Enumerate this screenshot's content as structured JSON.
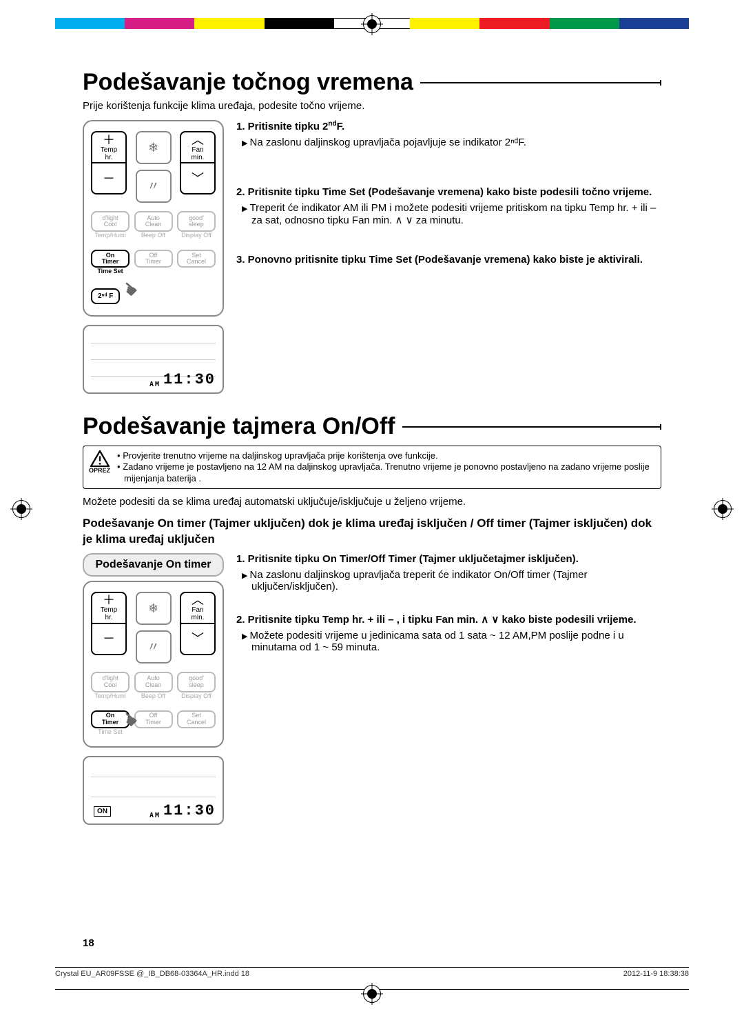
{
  "section1": {
    "title": "Podešavanje točnog vremena",
    "intro": "Prije korištenja funkcije klima uređaja, podesite točno vrijeme.",
    "steps": [
      {
        "lead": "1.   Pritisnite tipku 2",
        "lead_sup": "nd",
        "lead_tail": "F.",
        "body": "Na zaslonu daljinskog upravljača pojavljuje se indikator 2ⁿᵈF."
      },
      {
        "lead": "2.   Pritisnite tipku Time Set (Podešavanje vremena) kako biste podesili točno vrijeme.",
        "body": "Treperit će indikator AM ili PM i možete podesiti vrijeme pritiskom na tipku Temp hr. + ili – za sat, odnosno tipku Fan min. ∧ ∨  za minutu."
      },
      {
        "lead": "3.   Ponovno pritisnite tipku Time Set (Podešavanje vremena) kako biste je aktivirali.",
        "body": ""
      }
    ],
    "lcd": {
      "am": "AM",
      "time": "11:30"
    }
  },
  "section2": {
    "title": "Podešavanje tajmera On/Off",
    "caution_label": "OPREZ",
    "caution": [
      "Provjerite trenutno vrijeme na daljinskog upravljača prije korištenja ove funkcije.",
      "Zadano vrijeme je postavljeno na 12 AM na daljinskog upravljača. Trenutno vrijeme je ponovno postavljeno na zadano vrijeme poslije mijenjanja baterija ."
    ],
    "intro": "Možete podesiti da se klima uređaj automatski uključuje/isključuje u željeno vrijeme.",
    "subhead": "Podešavanje On timer (Tajmer uključen) dok je klima uređaj isključen / Off timer (Tajmer isključen) dok je klima uređaj uključen",
    "panel_label": "Podešavanje On timer",
    "steps": [
      {
        "lead": "1.   Pritisnite tipku On Timer/Off Timer (Tajmer uključetajmer isključen).",
        "body": "Na zaslonu daljinskog upravljača treperit će indikator On/Off timer (Tajmer uključen/isključen)."
      },
      {
        "lead": "2.   Pritisnite tipku Temp hr. + ili – , i tipku Fan min. ∧ ∨  kako biste podesili vrijeme.",
        "body": "Možete podesiti vrijeme u jedinicama sata od 1 sata ~ 12 AM,PM poslije podne i u minutama od 1 ~ 59 minuta."
      }
    ],
    "lcd": {
      "on": "ON",
      "am": "AM",
      "time": "11:30"
    }
  },
  "remote": {
    "temp": "Temp",
    "hr": "hr.",
    "fan": "Fan",
    "min": "min.",
    "dlight": "d'light",
    "cool": "Cool",
    "auto": "Auto",
    "clean": "Clean",
    "good": "good'",
    "sleep": "sleep",
    "sub1": "Temp/Humi",
    "sub2": "Beep Off",
    "sub3": "Display Off",
    "on": "On",
    "timer": "Timer",
    "off": "Off",
    "set": "Set",
    "cancel": "Cancel",
    "timeset": "Time Set",
    "secf": "2ⁿᵈ F"
  },
  "page_number": "18",
  "footer": {
    "file": "Crystal  EU_AR09FSSE @_IB_DB68-03364A_HR.indd   18",
    "date": "2012-11-9   18:38:38"
  },
  "colors": [
    "#000000",
    "#ffffff",
    "#00adee",
    "#d61f85",
    "#fff200",
    "#ed1b24",
    "#00984a",
    "#1b3f94"
  ]
}
